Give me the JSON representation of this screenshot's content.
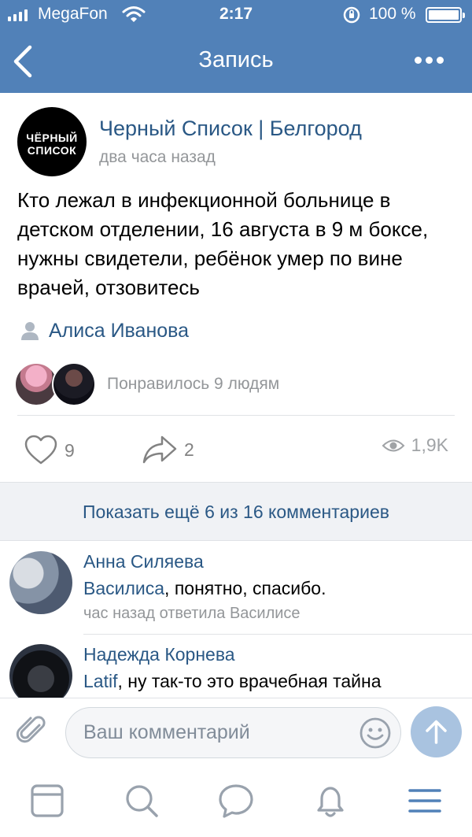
{
  "status_bar": {
    "carrier": "MegaFon",
    "time": "2:17",
    "battery": "100 %"
  },
  "nav": {
    "title": "Запись"
  },
  "post": {
    "group_avatar_text": "ЧЁРНЫЙ СПИСОК",
    "group_name": "Черный Список | Белгород",
    "time": "два часа назад",
    "text": "Кто лежал в инфекционной больнице в детском отделении, 16 августа в 9 м боксе, нужны свидетели, ребёнок умер по вине врачей, отзовитесь",
    "author": "Алиса Иванова",
    "likers_text": "Понравилось 9 людям",
    "likes": "9",
    "shares": "2",
    "views": "1,9K"
  },
  "comments": {
    "show_more": "Показать ещё 6 из 16 комментариев",
    "items": [
      {
        "name": "Анна Силяева",
        "mention": "Василиса",
        "text": ", понятно, спасибо.",
        "meta": "час назад ответила Василисе"
      },
      {
        "name": "Надежда Корнева",
        "mention": "Latif",
        "text": ", ну так-то это врачебная тайна",
        "meta": ""
      }
    ]
  },
  "composer": {
    "placeholder": "Ваш комментарий"
  },
  "tabbar": {
    "items": [
      "news-icon",
      "search-icon",
      "messages-icon",
      "notifications-icon",
      "menu-icon"
    ]
  },
  "colors": {
    "header": "#5181b8",
    "link": "#2a5885",
    "muted": "#939699"
  }
}
